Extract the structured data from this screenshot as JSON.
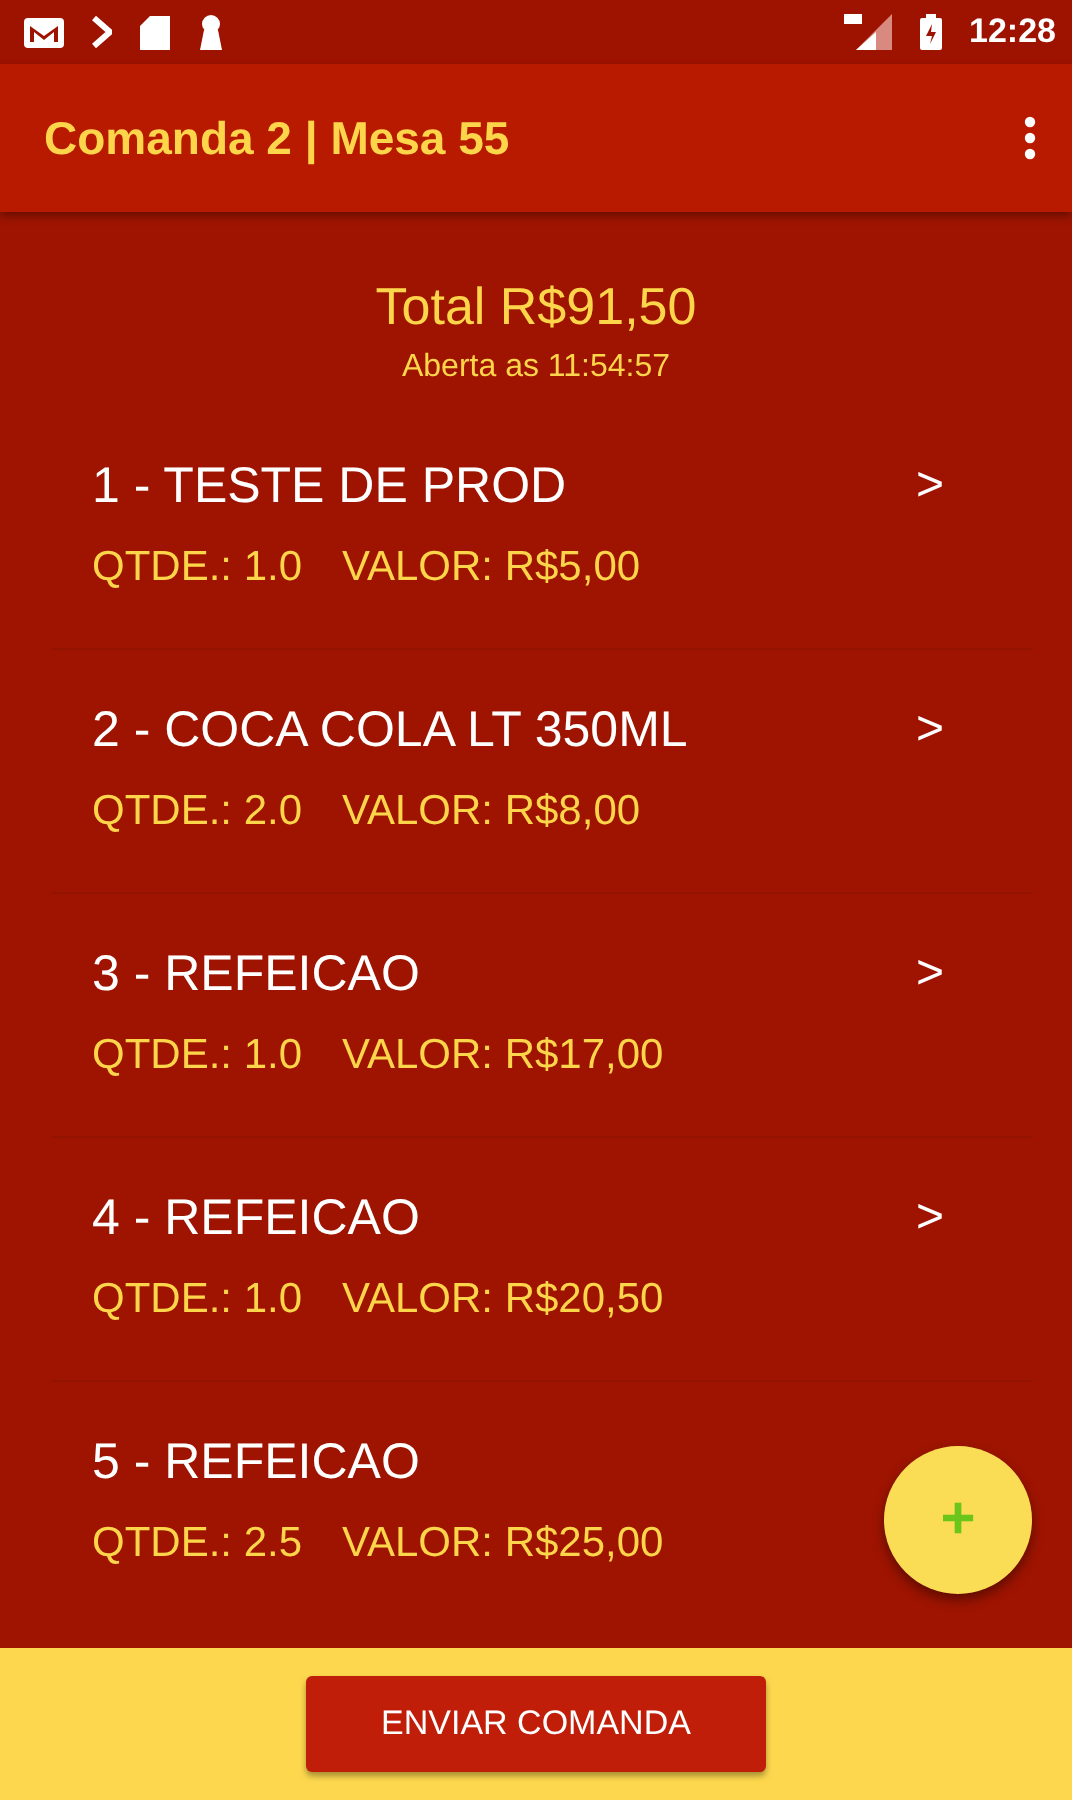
{
  "status_bar": {
    "time": "12:28"
  },
  "app_bar": {
    "title": "Comanda 2 | Mesa 55"
  },
  "summary": {
    "total": "Total R$91,50",
    "opened": "Aberta as 11:54:57"
  },
  "items": [
    {
      "title": "1 - TESTE DE PROD",
      "quantity": "QTDE.: 1.0",
      "value": "VALOR: R$5,00",
      "chevron": ">"
    },
    {
      "title": "2 - COCA COLA LT 350ML",
      "quantity": "QTDE.: 2.0",
      "value": "VALOR: R$8,00",
      "chevron": ">"
    },
    {
      "title": "3 - REFEICAO",
      "quantity": "QTDE.: 1.0",
      "value": "VALOR: R$17,00",
      "chevron": ">"
    },
    {
      "title": "4 - REFEICAO",
      "quantity": "QTDE.: 1.0",
      "value": "VALOR: R$20,50",
      "chevron": ">"
    },
    {
      "title": "5 - REFEICAO",
      "quantity": "QTDE.: 2.5",
      "value": "VALOR: R$25,00"
    }
  ],
  "fab": {
    "label": "+"
  },
  "send_button": {
    "label": "ENVIAR COMANDA"
  }
}
